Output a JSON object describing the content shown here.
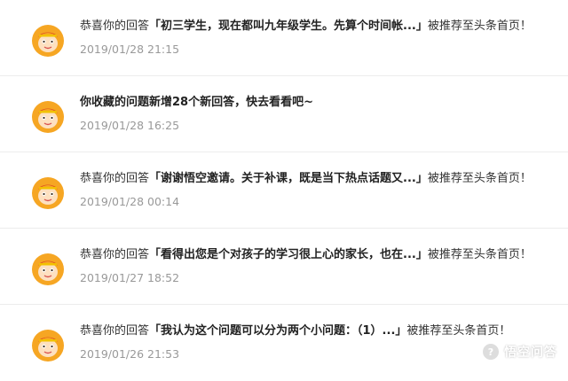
{
  "notifications": [
    {
      "prefix": "恭喜你的回答",
      "quote": "「初三学生，现在都叫九年级学生。先算个时间帐...」",
      "suffix": "被推荐至头条首页！",
      "time": "2019/01/28 21:15"
    },
    {
      "message": "你收藏的问题新增28个新回答，快去看看吧~",
      "time": "2019/01/28 16:25"
    },
    {
      "prefix": "恭喜你的回答",
      "quote": "「谢谢悟空邀请。关于补课，既是当下热点话题又...」",
      "suffix": "被推荐至头条首页！",
      "time": "2019/01/28 00:14"
    },
    {
      "prefix": "恭喜你的回答",
      "quote": "「看得出您是个对孩子的学习很上心的家长，也在...」",
      "suffix": "被推荐至头条首页！",
      "time": "2019/01/27 18:52"
    },
    {
      "prefix": "恭喜你的回答",
      "quote": "「我认为这个问题可以分为两个小问题：（1）...」",
      "suffix": "被推荐至头条首页！",
      "time": "2019/01/26 21:53"
    }
  ],
  "watermark": {
    "text": "悟空问答",
    "icon": "wukong-logo-icon"
  },
  "colors": {
    "avatar_bg": "#f6a623",
    "avatar_face": "#fde0c0",
    "time": "#999999",
    "divider": "#ececec"
  }
}
